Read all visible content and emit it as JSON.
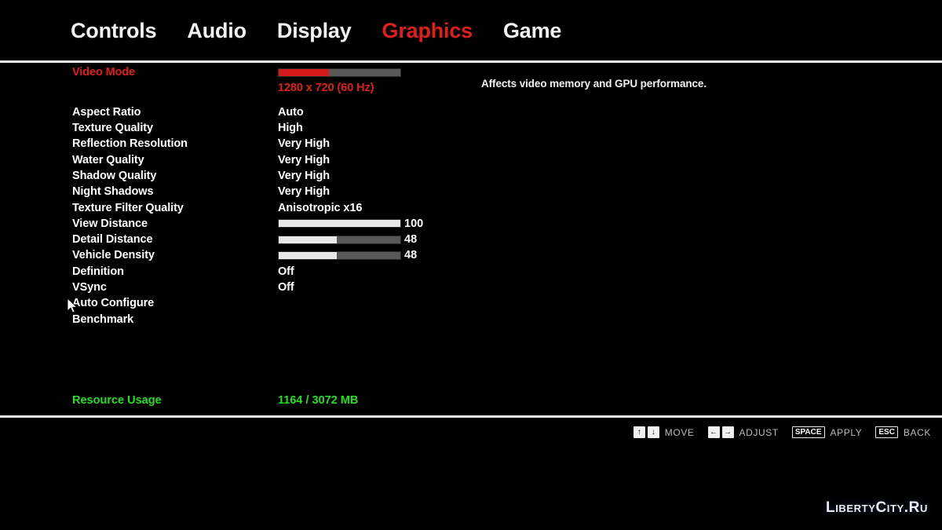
{
  "nav": {
    "tabs": [
      {
        "label": "Controls",
        "active": false
      },
      {
        "label": "Audio",
        "active": false
      },
      {
        "label": "Display",
        "active": false
      },
      {
        "label": "Graphics",
        "active": true
      },
      {
        "label": "Game",
        "active": false
      }
    ]
  },
  "accent_color": "#e01e1e",
  "ok_color": "#22e022",
  "settings": [
    {
      "label": "Video Mode",
      "type": "slider-and-text",
      "highlight": true,
      "fill_percent": 41,
      "value": "1280 x 720 (60 Hz)"
    },
    {
      "label": "Aspect Ratio",
      "type": "text",
      "value": "Auto"
    },
    {
      "label": "Texture Quality",
      "type": "text",
      "value": "High"
    },
    {
      "label": "Reflection Resolution",
      "type": "text",
      "value": "Very High"
    },
    {
      "label": "Water Quality",
      "type": "text",
      "value": "Very High"
    },
    {
      "label": "Shadow Quality",
      "type": "text",
      "value": "Very High"
    },
    {
      "label": "Night Shadows",
      "type": "text",
      "value": "Very High"
    },
    {
      "label": "Texture Filter Quality",
      "type": "text",
      "value": "Anisotropic x16"
    },
    {
      "label": "View Distance",
      "type": "slider",
      "fill_percent": 100,
      "value": "100"
    },
    {
      "label": "Detail Distance",
      "type": "slider",
      "fill_percent": 48,
      "value": "48"
    },
    {
      "label": "Vehicle Density",
      "type": "slider",
      "fill_percent": 48,
      "value": "48"
    },
    {
      "label": "Definition",
      "type": "text",
      "value": "Off"
    },
    {
      "label": "VSync",
      "type": "text",
      "value": "Off"
    },
    {
      "label": "Auto Configure",
      "type": "action",
      "value": ""
    },
    {
      "label": "Benchmark",
      "type": "action",
      "value": ""
    }
  ],
  "description": "Affects video memory and GPU performance.",
  "resource_usage": {
    "label": "Resource Usage",
    "value": "1164 / 3072 MB"
  },
  "footer_hints": [
    {
      "keys": [
        "↑",
        "↓"
      ],
      "arrow": true,
      "label": "MOVE"
    },
    {
      "keys": [
        "←",
        "→"
      ],
      "arrow": true,
      "label": "ADJUST"
    },
    {
      "keys": [
        "SPACE"
      ],
      "arrow": false,
      "label": "APPLY"
    },
    {
      "keys": [
        "ESC"
      ],
      "arrow": false,
      "label": "BACK"
    }
  ],
  "watermark": "LibertyCity.Ru"
}
